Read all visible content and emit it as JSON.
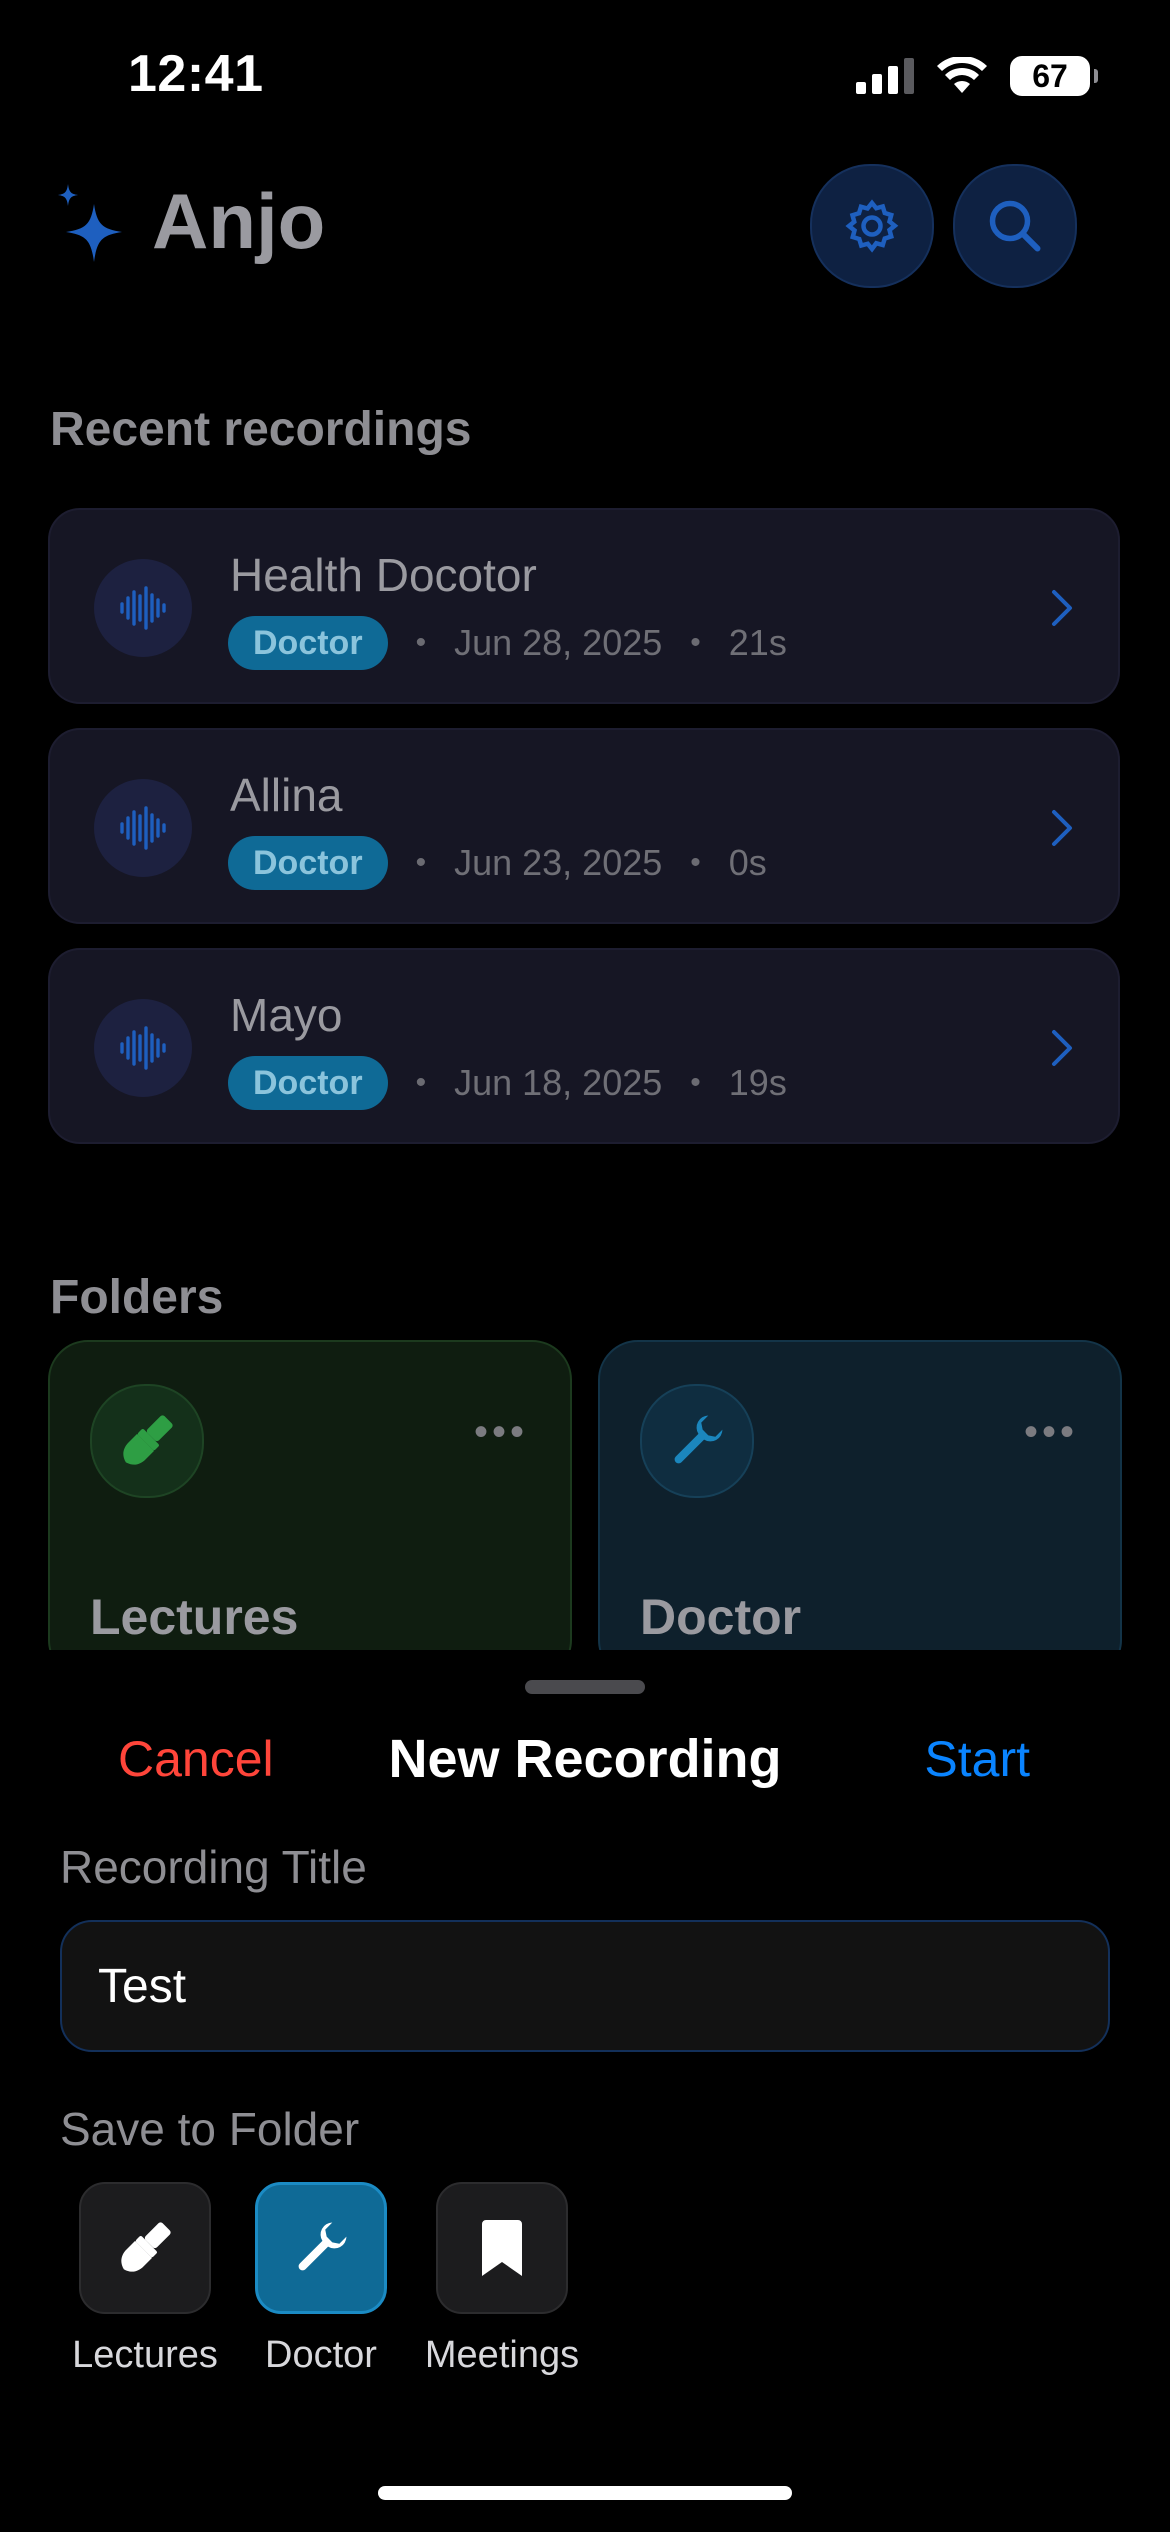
{
  "status_bar": {
    "time": "12:41",
    "battery": "67"
  },
  "header": {
    "app_name": "Anjo",
    "sparkle_icon": "sparkles-icon",
    "settings_icon": "gear-icon",
    "search_icon": "search-icon",
    "accent_color": "#1e5fbf"
  },
  "recent": {
    "title": "Recent recordings",
    "items": [
      {
        "title": "Health Docotor",
        "folder": "Doctor",
        "date": "Jun 28, 2025",
        "duration": "21s"
      },
      {
        "title": "Allina",
        "folder": "Doctor",
        "date": "Jun 23, 2025",
        "duration": "0s"
      },
      {
        "title": "Mayo",
        "folder": "Doctor",
        "date": "Jun 18, 2025",
        "duration": "19s"
      }
    ]
  },
  "folders": {
    "title": "Folders",
    "items": [
      {
        "name": "Lectures",
        "icon": "paintbrush-icon",
        "color": "#2e7d32"
      },
      {
        "name": "Doctor",
        "icon": "wrench-icon",
        "color": "#0f6a96"
      }
    ]
  },
  "sheet": {
    "cancel": "Cancel",
    "title": "New Recording",
    "start": "Start",
    "title_label": "Recording Title",
    "title_value": "Test",
    "folder_label": "Save to Folder",
    "folder_options": [
      {
        "label": "Lectures",
        "icon": "paintbrush-icon",
        "selected": false
      },
      {
        "label": "Doctor",
        "icon": "wrench-icon",
        "selected": true
      },
      {
        "label": "Meetings",
        "icon": "bookmark-icon",
        "selected": false
      }
    ]
  },
  "colors": {
    "cancel": "#ff453a",
    "start": "#0a84ff",
    "badge": "#0f6a96"
  }
}
